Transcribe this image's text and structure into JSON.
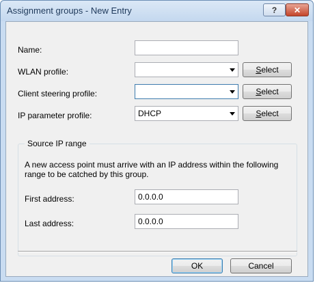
{
  "window": {
    "title": "Assignment groups - New Entry",
    "help_symbol": "?",
    "close_symbol": "✕"
  },
  "fields": {
    "name": {
      "label": "Name:",
      "value": ""
    },
    "wlan_profile": {
      "label": "WLAN profile:",
      "value": ""
    },
    "client_steering_profile": {
      "label": "Client steering profile:",
      "value": ""
    },
    "ip_parameter_profile": {
      "label": "IP parameter profile:",
      "value": "DHCP"
    }
  },
  "select_button": {
    "accel": "S",
    "rest": "elect"
  },
  "source_ip_range": {
    "title": "Source IP range",
    "description": "A new access point must arrive with an IP address within the following range to be catched by this group.",
    "first_address": {
      "label": "First address:",
      "value": "0.0.0.0"
    },
    "last_address": {
      "label": "Last address:",
      "value": "0.0.0.0"
    }
  },
  "footer": {
    "ok_label": "OK",
    "cancel_label": "Cancel"
  }
}
